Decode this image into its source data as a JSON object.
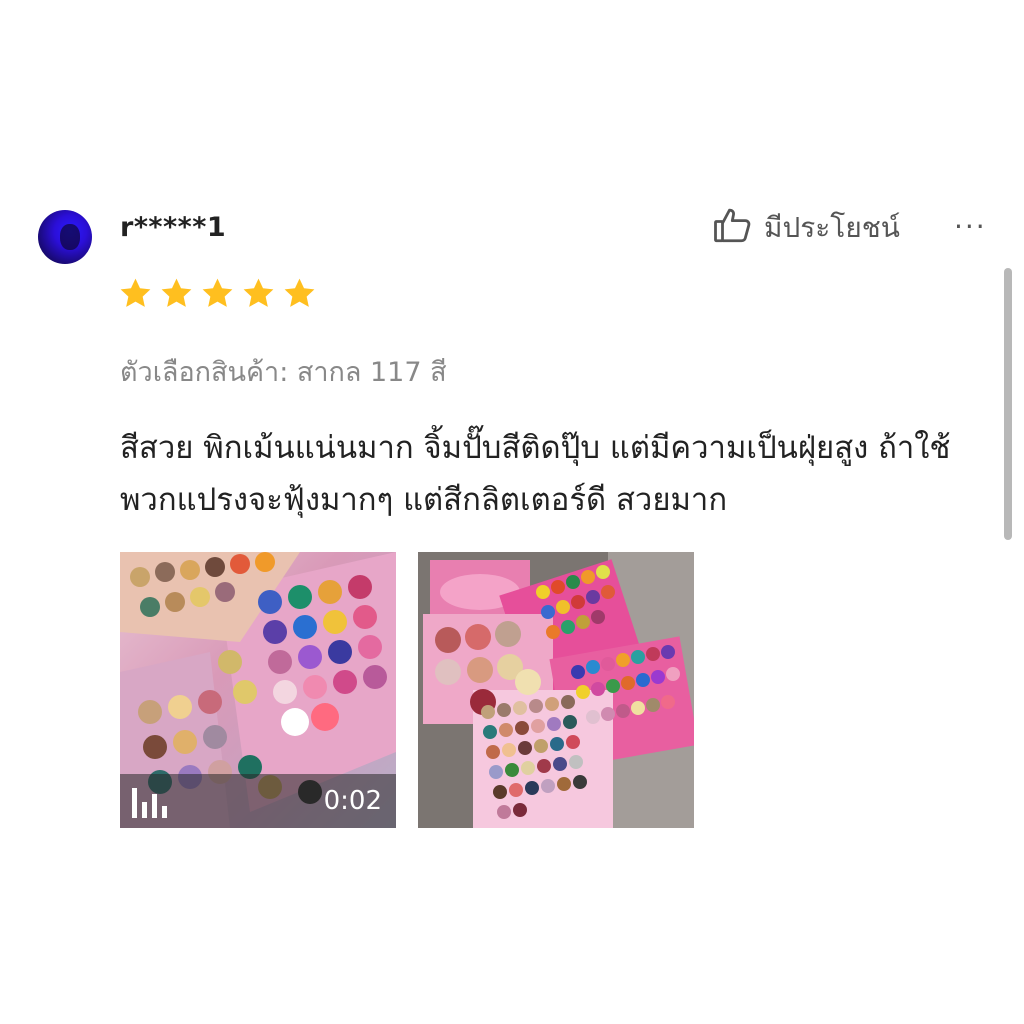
{
  "review": {
    "username": "r*****1",
    "rating": 5,
    "helpful_label": "มีประโยชน์",
    "more_label": "···",
    "variation": "ตัวเลือกสินค้า: สากล 117 สี",
    "comment": "สีสวย พิกเม้นแน่นมาก จิ้มปั๊บสีติดปุ๊บ แต่มีความเป็นฝุ่ยสูง ถ้าใช้พวกแปรงจะฟุ้งมากๆ แต่สีกลิตเตอร์ดี สวยมาก",
    "media": [
      {
        "type": "video",
        "duration": "0:02",
        "icon": "video-bars-icon"
      },
      {
        "type": "image",
        "icon": "photo"
      }
    ]
  },
  "colors": {
    "star": "#FFBF1F",
    "helpful_text": "#555555",
    "variation_text": "#888888",
    "comment_text": "#222222"
  },
  "icons": {
    "helpful": "thumbs-up-icon",
    "more": "ellipsis-icon",
    "star": "star-icon"
  }
}
